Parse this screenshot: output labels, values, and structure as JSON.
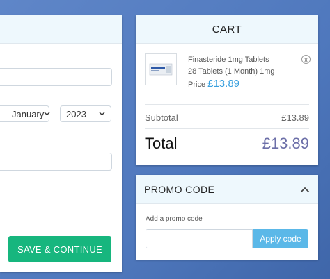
{
  "form": {
    "month_value": "January",
    "year_value": "2023",
    "save_label": "SAVE & CONTINUE"
  },
  "cart": {
    "title": "CART",
    "item": {
      "name_line1": "Finasteride 1mg Tablets",
      "name_line2": "28 Tablets (1 Month) 1mg",
      "price_label": "Price",
      "price": "£13.89",
      "remove_icon": "x"
    },
    "subtotal_label": "Subtotal",
    "subtotal_value": "£13.89",
    "total_label": "Total",
    "total_value": "£13.89"
  },
  "promo": {
    "title": "PROMO CODE",
    "caret": "^",
    "input_label": "Add a promo code",
    "input_value": "",
    "apply_label": "Apply code"
  },
  "colors": {
    "save_button": "#17b67e",
    "price_blue": "#3aa0de",
    "total_purple": "#6c6fa8",
    "apply_button": "#5bb8e8"
  }
}
